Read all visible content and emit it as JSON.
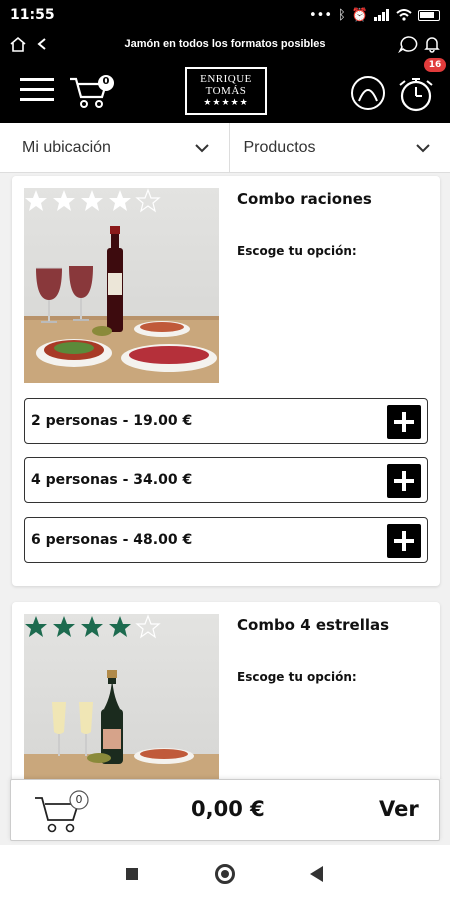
{
  "status_bar": {
    "time": "11:55",
    "icons": [
      "dots-icon",
      "bluetooth-icon",
      "alarm-icon",
      "signal-icon",
      "wifi-icon",
      "battery-icon"
    ]
  },
  "browser": {
    "title": "Jamón en todos los formatos posibles"
  },
  "header": {
    "cart_count": "0",
    "logo_line1": "ENRIQUE",
    "logo_line2": "TOMÁS",
    "logo_stars": "★★★★★",
    "timer_badge": "16"
  },
  "filters": {
    "location_label": "Mi ubicación",
    "products_label": "Productos"
  },
  "products": [
    {
      "title": "Combo raciones",
      "subtitle": "Escoge tu opción:",
      "rating": 4,
      "star_color": "#ffffff",
      "options": [
        {
          "label": "2 personas - 19.00 €"
        },
        {
          "label": "4 personas - 34.00 €"
        },
        {
          "label": "6 personas - 48.00 €"
        }
      ]
    },
    {
      "title": "Combo 4 estrellas",
      "subtitle": "Escoge tu opción:",
      "rating": 4,
      "star_color": "#1d6b4f"
    }
  ],
  "cart_bar": {
    "count": "0",
    "total": "0,00 €",
    "view_label": "Ver"
  },
  "colors": {
    "accent_badge": "#e13b3b",
    "header_bg": "#000000",
    "green_star": "#1d6b4f"
  }
}
